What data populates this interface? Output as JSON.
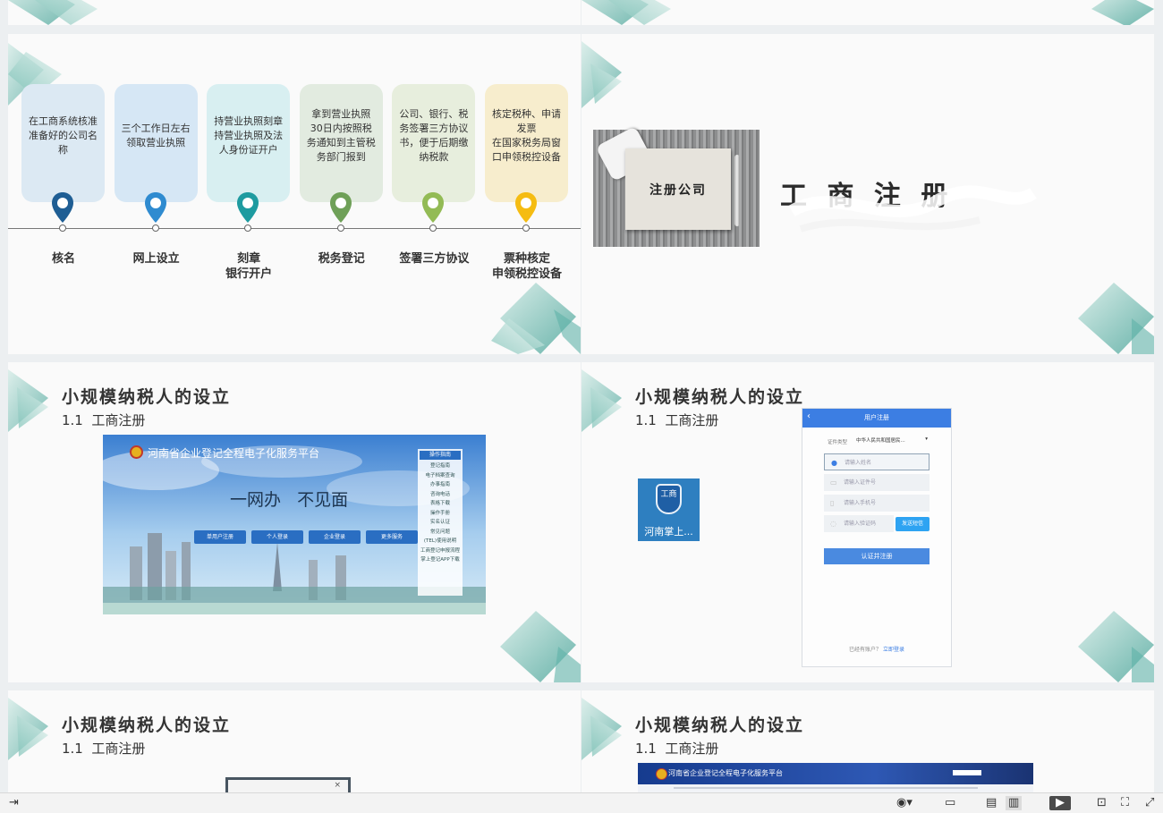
{
  "slide2": {
    "steps": [
      {
        "desc": "在工商系统核准准备好的公司名称",
        "label": "核名",
        "card_color": "#dce9f3",
        "pin_color": "#1f5e94"
      },
      {
        "desc": "三个工作日左右领取营业执照",
        "label": "网上设立",
        "card_color": "#d6e7f5",
        "pin_color": "#2f8bd0"
      },
      {
        "desc": "持营业执照刻章\n持营业执照及法人身份证开户",
        "label": "刻章\n银行开户",
        "card_color": "#d8eff1",
        "pin_color": "#1e9ba0"
      },
      {
        "desc": "拿到营业执照30日内按照税务通知到主管税务部门报到",
        "label": "税务登记",
        "card_color": "#e2ebe0",
        "pin_color": "#6fa058"
      },
      {
        "desc": "公司、银行、税务签署三方协议书，便于后期缴纳税款",
        "label": "签署三方协议",
        "card_color": "#e7eedd",
        "pin_color": "#93bb55"
      },
      {
        "desc": "核定税种、申请发票\n在国家税务局窗口申领税控设备",
        "label": "票种核定\n申领税控设备",
        "card_color": "#f7edcd",
        "pin_color": "#f5bc12"
      }
    ]
  },
  "slide3": {
    "card_text": "注册公司",
    "heading": "工 商 注 册"
  },
  "slide4": {
    "title": "小规模纳税人的设立",
    "subtitle": "1.1  工商注册",
    "site_title": "河南省企业登记全程电子化服务平台",
    "slogan": "一网办   不见面",
    "buttons": [
      "单用户注册",
      "个人登录",
      "企业登录",
      "更多服务"
    ],
    "menu_header": "操作指南",
    "menu": [
      "登记指南",
      "电子档案查询",
      "办事指南",
      "咨询电话",
      "表格下载",
      "操作手册",
      "实名认证",
      "常见问题",
      "(TEL)使用说明",
      "工商登记申报流程",
      "掌上登记APP下载"
    ]
  },
  "slide5": {
    "title": "小规模纳税人的设立",
    "subtitle": "1.1  工商注册",
    "app_icon_char": "工商",
    "app_name": "河南掌上...",
    "phone_header": "用户注册",
    "cert_type_label": "证件类型",
    "cert_type_value": "中华人民共和国居民...",
    "fields": [
      "请输入姓名",
      "请输入证件号",
      "请输入手机号",
      "请输入验证码"
    ],
    "send_code": "发送短信",
    "submit": "认证并注册",
    "footer_text": "已经有账户？",
    "footer_link": "立即登录"
  },
  "slide6": {
    "title": "小规模纳税人的设立",
    "subtitle": "1.1  工商注册"
  },
  "slide7": {
    "title": "小规模纳税人的设立",
    "subtitle": "1.1  工商注册",
    "site_title": "河南省企业登记全程电子化服务平台"
  },
  "statusbar": {
    "icons": [
      "exit-icon",
      "eye-icon",
      "normal-view-icon",
      "page-view-icon",
      "reading-view-icon",
      "play-icon",
      "actual-size-icon",
      "fit-icon",
      "fullscreen-icon"
    ]
  },
  "colors": {
    "accent_teal": "#5fb3a8",
    "blue": "#3d7fe0"
  }
}
